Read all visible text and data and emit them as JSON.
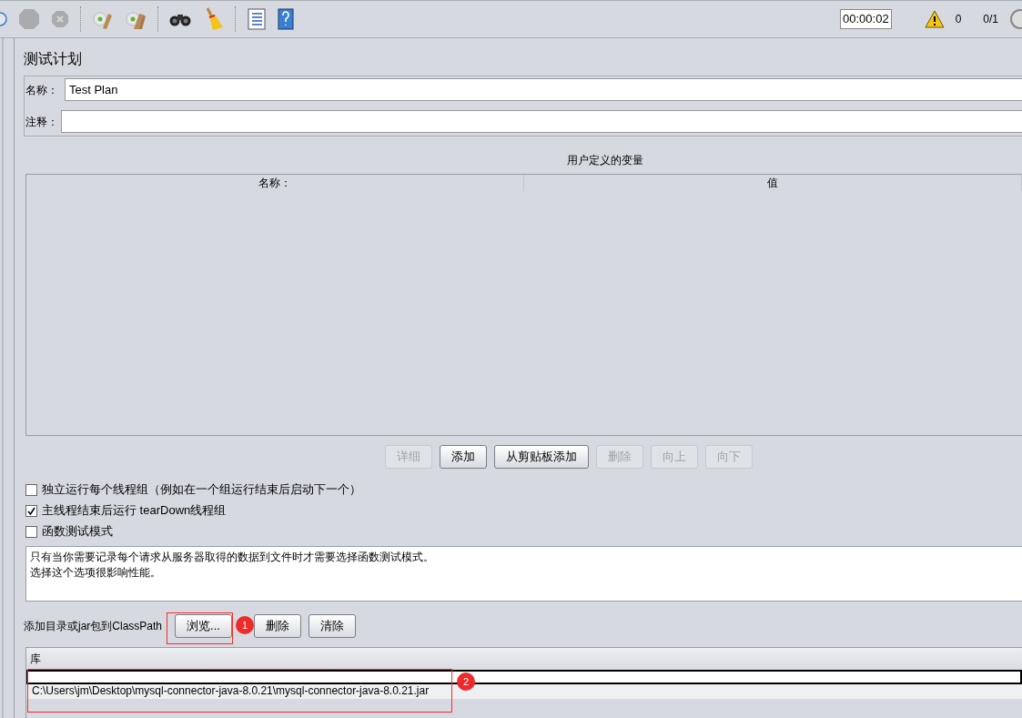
{
  "toolbar": {
    "timer": "00:00:02",
    "warnings": "0",
    "threads": "0/1"
  },
  "panel": {
    "title": "测试计划",
    "name_field": {
      "label": "名称：",
      "value": "Test Plan"
    },
    "comment_field": {
      "label": "注释："
    },
    "variables": {
      "title": "用户定义的变量",
      "columns": [
        "名称：",
        "值"
      ],
      "buttons": [
        {
          "label": "详细",
          "disabled": true
        },
        {
          "label": "添加",
          "disabled": false
        },
        {
          "label": "从剪贴板添加",
          "disabled": false
        },
        {
          "label": "删除",
          "disabled": true
        },
        {
          "label": "向上",
          "disabled": true
        },
        {
          "label": "向下",
          "disabled": true
        }
      ]
    },
    "options": [
      {
        "label": "独立运行每个线程组（例如在一个组运行结束后启动下一个）",
        "checked": false
      },
      {
        "label": "主线程结束后运行 tearDown线程组",
        "checked": true
      },
      {
        "label": "函数测试模式",
        "checked": false
      }
    ],
    "info": [
      "只有当你需要记录每个请求从服务器取得的数据到文件时才需要选择函数测试模式。",
      "选择这个选项很影响性能。"
    ],
    "classpath": {
      "label": "添加目录或jar包到ClassPath",
      "buttons": [
        "浏览...",
        "删除",
        "清除"
      ],
      "table": {
        "column": "库",
        "rows": [
          {
            "value": "",
            "selected": true
          },
          {
            "value": "C:\\Users\\jm\\Desktop\\mysql-connector-java-8.0.21\\mysql-connector-java-8.0.21.jar",
            "selected": false
          }
        ]
      }
    }
  },
  "annotations": [
    {
      "label": "1"
    },
    {
      "label": "2"
    }
  ]
}
